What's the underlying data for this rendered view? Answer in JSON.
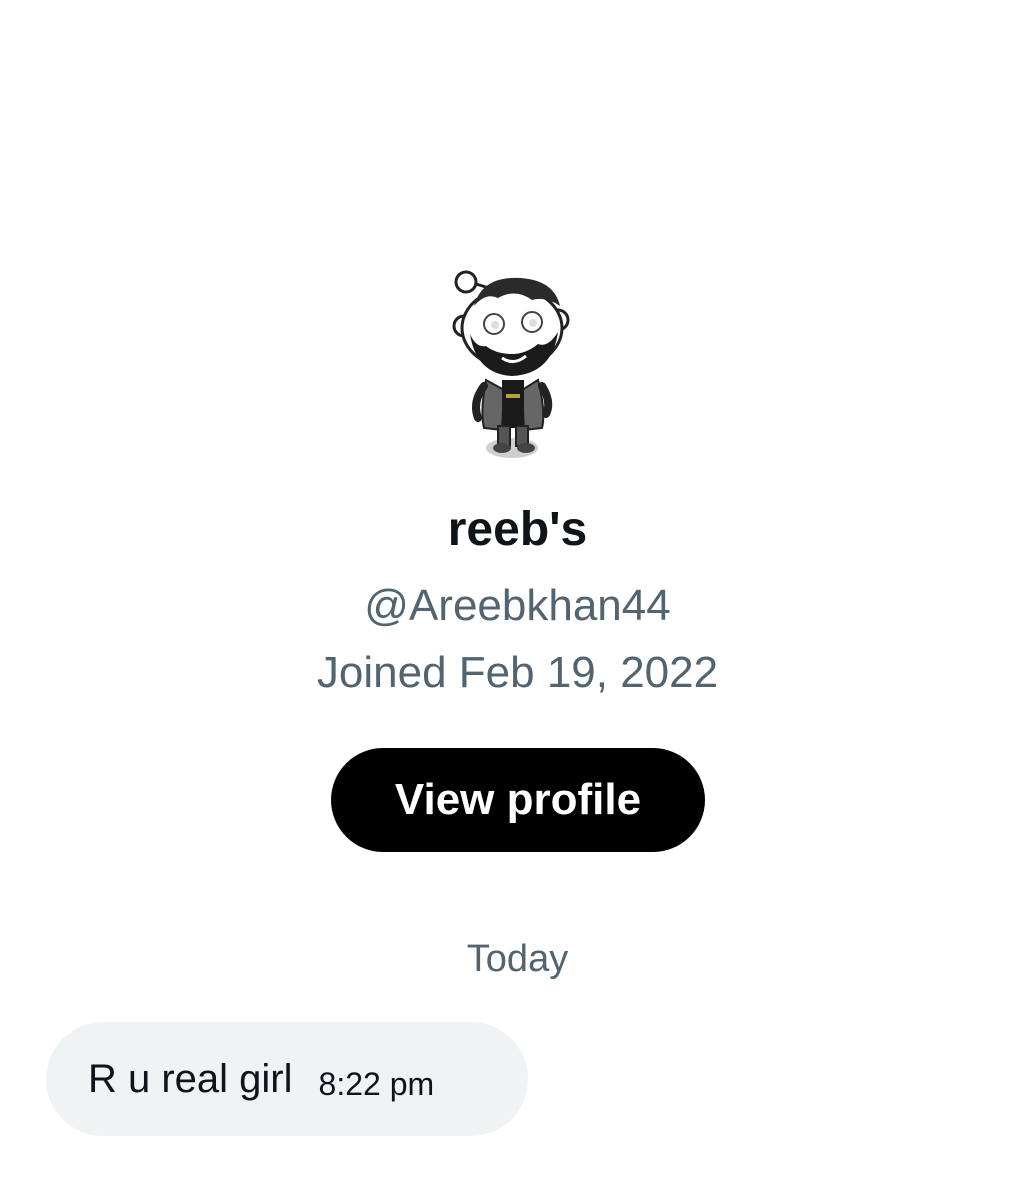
{
  "profile": {
    "avatar_icon": "snoo-avatar-icon",
    "display_name": "reeb's",
    "handle": "@Areebkhan44",
    "joined": "Joined Feb 19, 2022",
    "view_profile_label": "View profile"
  },
  "conversation": {
    "date_divider": "Today",
    "messages": [
      {
        "text": "R u real girl",
        "time": "8:22 pm"
      }
    ]
  },
  "colors": {
    "primary_text": "#0f1419",
    "secondary_text": "#536471",
    "button_bg": "#000000",
    "bubble_bg": "#eff3f4"
  }
}
